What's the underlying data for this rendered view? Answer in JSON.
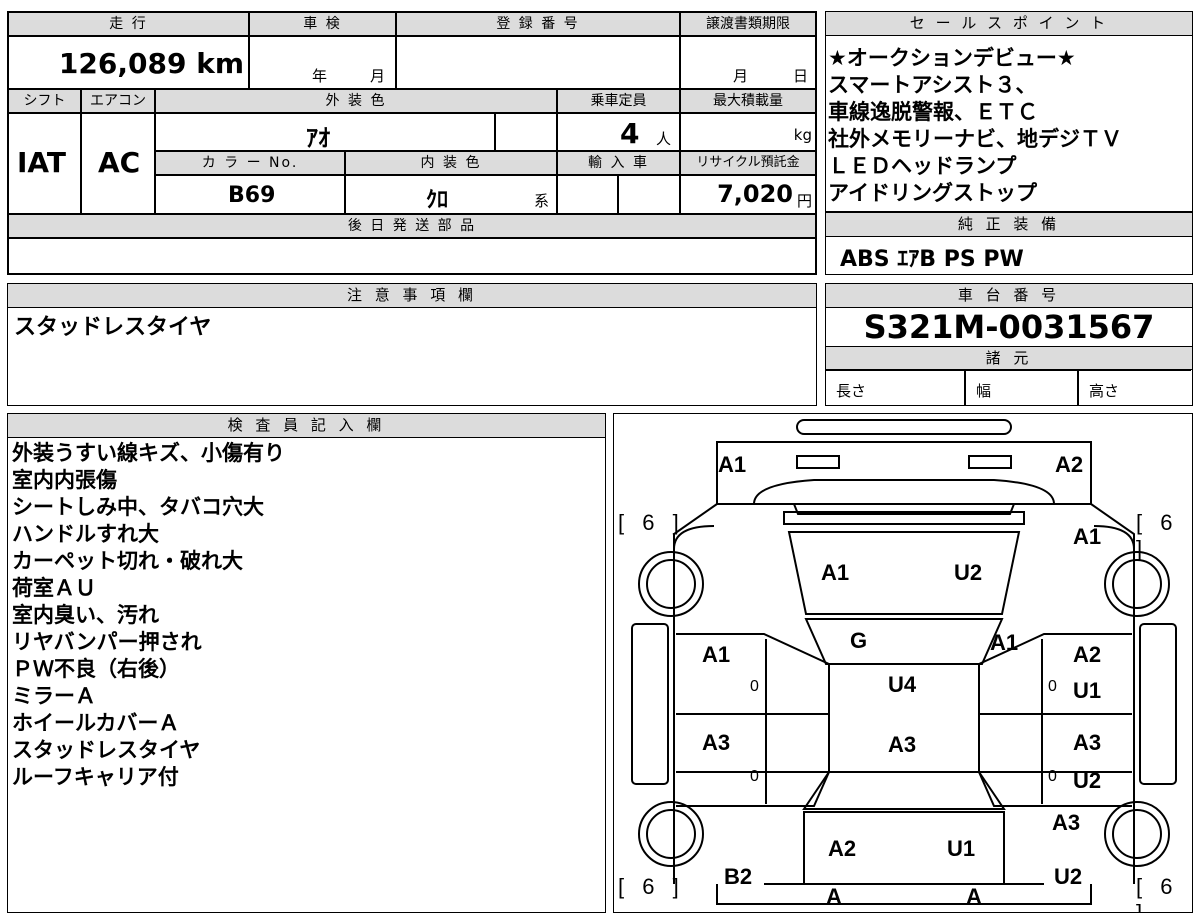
{
  "top": {
    "mileage_header": "走 行",
    "shaken_header": "車 検",
    "registration_header": "登 録 番 号",
    "transfer_deadline_header": "譲渡書類期限",
    "mileage_value": "126,089 km",
    "shaken_year": "年",
    "shaken_month": "月",
    "deadline_month": "月",
    "deadline_day": "日",
    "shift_header": "シフト",
    "aircon_header": "エアコン",
    "exterior_header": "外 装 色",
    "capacity_header": "乗車定員",
    "max_load_header": "最大積載量",
    "shift_value": "IAT",
    "aircon_value": "AC",
    "exterior_value": "ｱｵ",
    "capacity_value": "4",
    "capacity_unit": "人",
    "load_unit": "kg",
    "color_no_header": "カ ラ ー No.",
    "interior_header": "内 装 色",
    "import_header": "輸 入 車",
    "recycle_header": "リサイクル預託金",
    "color_no_value": "B69",
    "interior_value": "ｸﾛ",
    "interior_suffix": "系",
    "recycle_value": "7,020",
    "recycle_unit": "円",
    "later_parts_header": "後 日 発 送 部 品"
  },
  "sales": {
    "header": "セ ー ル ス ポ イ ン ト",
    "lines": [
      "★オークションデビュー★",
      "スマートアシスト３、",
      "車線逸脱警報、ＥＴＣ",
      "社外メモリーナビ、地デジＴＶ",
      "ＬＥＤヘッドランプ",
      "アイドリングストップ"
    ]
  },
  "equipment": {
    "header": "純 正 装 備",
    "value": "ABS ｴｱB PS PW"
  },
  "notes": {
    "header": "注 意 事 項 欄",
    "value": "スタッドレスタイヤ"
  },
  "chassis": {
    "header": "車 台 番 号",
    "value": "S321M-0031567",
    "specs_header": "諸 元",
    "length": "長さ",
    "width": "幅",
    "height": "高さ"
  },
  "inspector": {
    "header": "検 査 員 記 入 欄",
    "lines": [
      "外装うすい線キズ、小傷有り",
      "室内内張傷",
      "シートしみ中、タバコ穴大",
      "ハンドルすれ大",
      "カーペット切れ・破れ大",
      "荷室ＡＵ",
      "室内臭い、汚れ",
      "リヤバンパー押され",
      "ＰＷ不良（右後）",
      "ミラーＡ",
      "ホイールカバーＡ",
      "スタッドレスタイヤ",
      "ルーフキャリア付"
    ]
  },
  "diagram": {
    "front_left": "A1",
    "front_right": "A2",
    "tire_fl": "[ 6 ]",
    "tire_fr": "[ 6 ]",
    "tire_rl": "[ 6 ]",
    "tire_rr": "[ 6 ]",
    "fender_r_front": "A1",
    "hood_left": "A1",
    "hood_right": "U2",
    "windshield": "G",
    "pillar_right": "A1",
    "door_fl": "A1",
    "door_fl_small": "0",
    "door_fr": "A2",
    "door_fr_small": "0",
    "door_fr_extra": "U1",
    "roof": "U4",
    "roof_rear": "A3",
    "door_rl": "A3",
    "door_rl_small": "0",
    "door_rr": "A3",
    "door_rr_small": "0",
    "door_rr_extra": "U2",
    "quarter_r": "A3",
    "back_left": "A2",
    "back_right": "U1",
    "rear_left": "B2",
    "rear_right": "U2",
    "bottom_left": "A",
    "bottom_right": "A"
  }
}
